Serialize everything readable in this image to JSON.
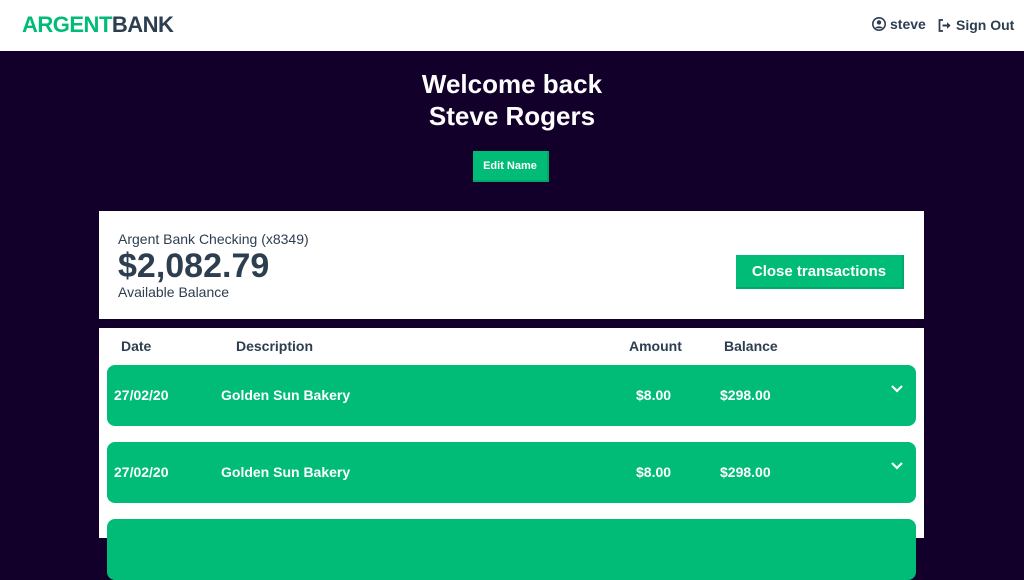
{
  "header": {
    "logo_part1": "ARGENT",
    "logo_part2": "BANK",
    "user_label": "steve",
    "signout_label": "Sign Out"
  },
  "hero": {
    "welcome_line1": "Welcome back",
    "welcome_line2": "Steve Rogers",
    "edit_label": "Edit Name"
  },
  "account": {
    "title": "Argent Bank Checking (x8349)",
    "amount": "$2,082.79",
    "description": "Available Balance",
    "close_label": "Close transactions"
  },
  "transactions": {
    "headers": {
      "date": "Date",
      "description": "Description",
      "amount": "Amount",
      "balance": "Balance"
    },
    "rows": [
      {
        "date": "27/02/20",
        "description": "Golden Sun Bakery",
        "amount": "$8.00",
        "balance": "$298.00"
      },
      {
        "date": "27/02/20",
        "description": "Golden Sun Bakery",
        "amount": "$8.00",
        "balance": "$298.00"
      },
      {
        "date": "",
        "description": "",
        "amount": "",
        "balance": ""
      }
    ]
  },
  "colors": {
    "accent": "#00bc77",
    "text_dark": "#2c3e50",
    "background": "#12002b"
  },
  "icons": {
    "user": "user-circle-icon",
    "signout": "sign-out-icon",
    "expand": "chevron-down-icon"
  }
}
